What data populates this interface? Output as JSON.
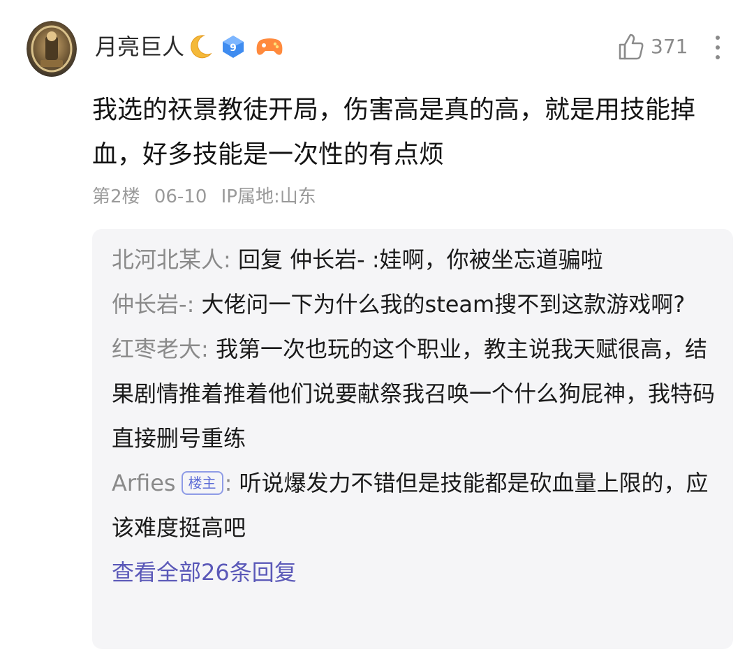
{
  "post": {
    "author": {
      "name": "月亮巨人",
      "level_badge": "9"
    },
    "likes": "371",
    "content": "我选的祆景教徒开局，伤害高是真的高，就是用技能掉血，好多技能是一次性的有点烦",
    "meta": {
      "floor": "第2楼",
      "date": "06-10",
      "ip": "IP属地:山东"
    }
  },
  "replies": [
    {
      "author": "北河北某人",
      "sep": ":",
      "text": " 回复 仲长岩- :娃啊，你被坐忘道骗啦",
      "is_op": false
    },
    {
      "author": "仲长岩-",
      "sep": ":",
      "text": " 大佬问一下为什么我的steam搜不到这款游戏啊?",
      "is_op": false
    },
    {
      "author": "红枣老大",
      "sep": ":",
      "text": " 我第一次也玩的这个职业，教主说我天赋很高，结果剧情推着推着他们说要献祭我召唤一个什么狗屁神，我特码直接删号重练",
      "is_op": false
    },
    {
      "author": "Arfies",
      "op_label": "楼主",
      "sep": ":",
      "text": " 听说爆发力不错但是技能都是砍血量上限的，应该难度挺高吧",
      "is_op": true
    }
  ],
  "view_all_label": "查看全部26条回复",
  "colors": {
    "link": "#5a58b8",
    "muted": "#9a9a9a",
    "reply_bg": "#f5f5f7",
    "op_badge": "#5b6bd6"
  },
  "icons": [
    "moon-icon",
    "diamond-badge-icon",
    "gamepad-icon",
    "thumbs-up-icon",
    "more-vertical-icon"
  ]
}
